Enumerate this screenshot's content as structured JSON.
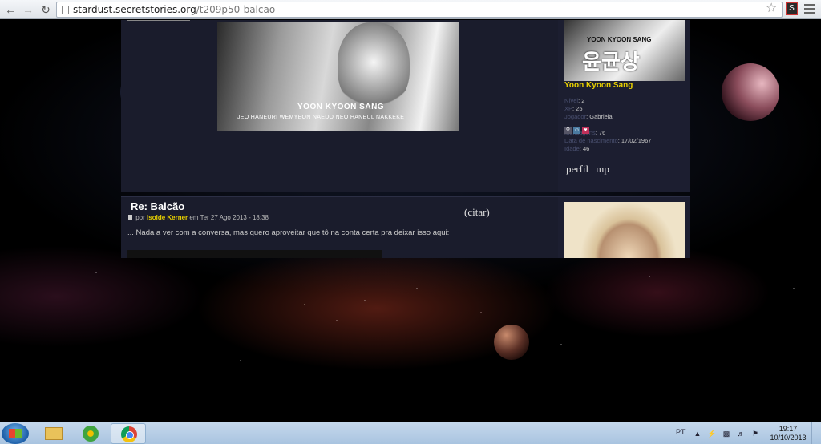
{
  "browser": {
    "url_domain": "stardust.secretstories.org",
    "url_path": "/t209p50-balcao"
  },
  "post1": {
    "signature_title": "YOON KYOON SANG",
    "signature_lyric": "JEO HANEURI WEMYEON NAEDO NEO HANEUL NAKKEKE",
    "avatar_caption": "YOON KYOON SANG",
    "avatar_korean": "윤균상",
    "username": "Yoon Kyoon Sang",
    "fields": [
      {
        "label": "Nível",
        "value": ": 2"
      },
      {
        "label": "XP",
        "value": ": 25"
      },
      {
        "label": "Jogador",
        "value": ": Gabriela"
      },
      {
        "label": "Mensagens",
        "value": ": 76"
      },
      {
        "label": "Data de nascimento",
        "value": ": 17/02/1967"
      },
      {
        "label": "Idade",
        "value": ": 46"
      }
    ],
    "profile_link": "perfil",
    "separator": "|",
    "pm_link": "mp"
  },
  "post2": {
    "title": "Re: Balcão",
    "quote_label": "(citar)",
    "by_label": "por",
    "author": "Isolde Kerner",
    "date": "em Ter 27 Ago 2013 - 18:38",
    "text": "... Nada a ver com a conversa, mas quero aproveitar que tô na conta certa pra deixar isso aqui:"
  },
  "taskbar": {
    "language": "PT",
    "time": "19:17",
    "date": "10/10/2013"
  }
}
